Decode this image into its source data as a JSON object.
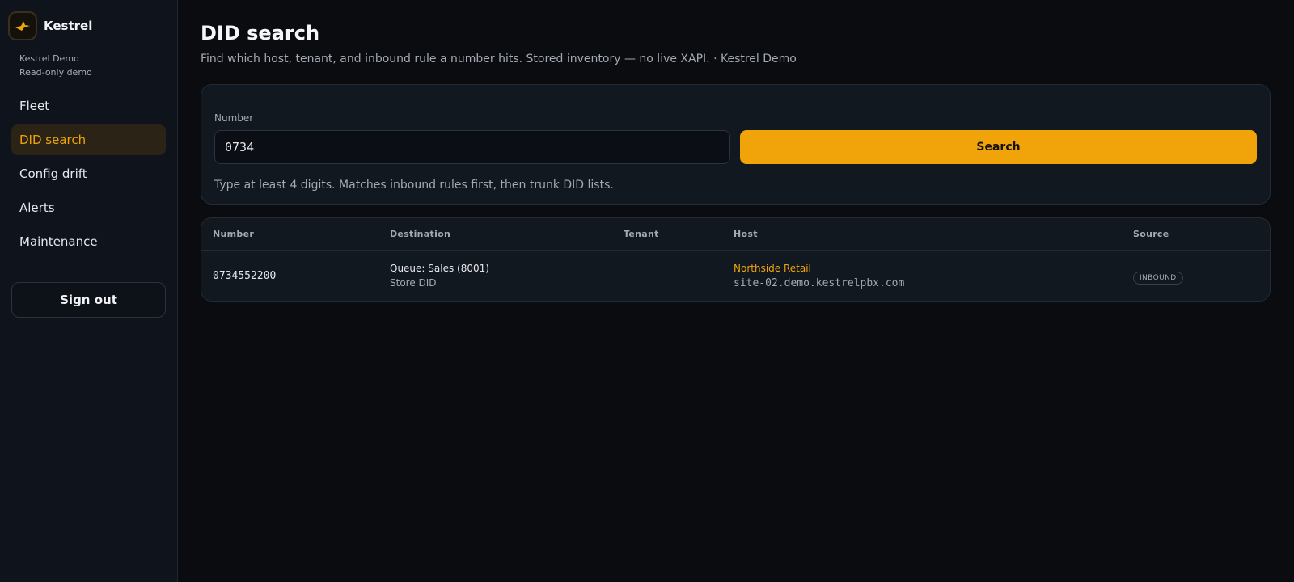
{
  "brand": {
    "name": "Kestrel",
    "org": "Kestrel Demo",
    "mode": "Read-only demo",
    "logo_icon": "bird-icon",
    "accent": "#f0a40a"
  },
  "nav": {
    "items": [
      {
        "label": "Fleet",
        "active": false
      },
      {
        "label": "DID search",
        "active": true
      },
      {
        "label": "Config drift",
        "active": false
      },
      {
        "label": "Alerts",
        "active": false
      },
      {
        "label": "Maintenance",
        "active": false
      }
    ],
    "signout_label": "Sign out"
  },
  "page": {
    "title": "DID search",
    "subtitle": "Find which host, tenant, and inbound rule a number hits. Stored inventory — no live XAPI. · Kestrel Demo"
  },
  "search": {
    "label": "Number",
    "value": "0734",
    "button_label": "Search",
    "hint": "Type at least 4 digits. Matches inbound rules first, then trunk DID lists."
  },
  "results": {
    "columns": [
      "Number",
      "Destination",
      "Tenant",
      "Host",
      "Source"
    ],
    "rows": [
      {
        "number": "0734552200",
        "destination": "Queue: Sales (8001)",
        "destination_sub": "Store DID",
        "tenant": "—",
        "host_name": "Northside Retail",
        "host_addr": "site-02.demo.kestrelpbx.com",
        "source": "INBOUND"
      }
    ]
  }
}
